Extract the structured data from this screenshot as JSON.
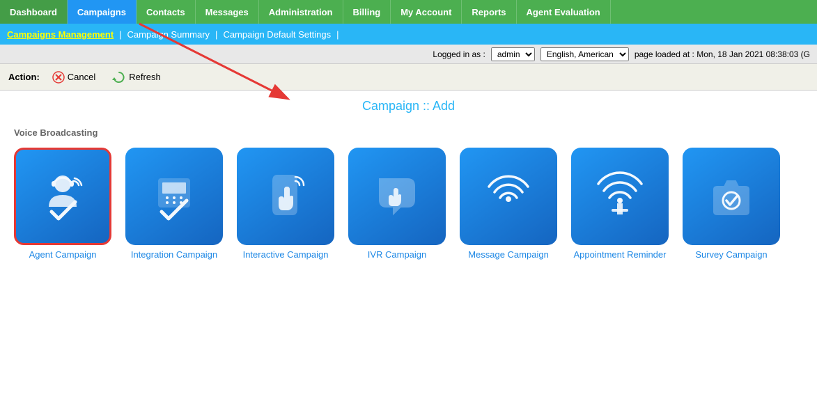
{
  "nav": {
    "items": [
      {
        "label": "Dashboard",
        "active": false
      },
      {
        "label": "Campaigns",
        "active": true
      },
      {
        "label": "Contacts",
        "active": false
      },
      {
        "label": "Messages",
        "active": false
      },
      {
        "label": "Administration",
        "active": false
      },
      {
        "label": "Billing",
        "active": false
      },
      {
        "label": "My Account",
        "active": false
      },
      {
        "label": "Reports",
        "active": false
      },
      {
        "label": "Agent Evaluation",
        "active": false
      }
    ]
  },
  "subnav": {
    "links": [
      {
        "label": "Campaigns Management",
        "type": "yellow-link"
      },
      {
        "label": "|",
        "type": "sep"
      },
      {
        "label": "Campaign Summary",
        "type": "white-link"
      },
      {
        "label": "|",
        "type": "sep"
      },
      {
        "label": "Campaign Default Settings",
        "type": "white-link"
      },
      {
        "label": "|",
        "type": "sep"
      }
    ]
  },
  "statusbar": {
    "logged_in_label": "Logged in as :",
    "user": "admin",
    "language_options": [
      "English, American"
    ],
    "language_selected": "English, American",
    "page_loaded": "page loaded at : Mon, 18 Jan 2021 08:38:03 (G"
  },
  "actionbar": {
    "action_label": "Action:",
    "cancel_label": "Cancel",
    "refresh_label": "Refresh"
  },
  "page_title": "Campaign :: Add",
  "section": {
    "label": "Voice Broadcasting"
  },
  "campaigns": [
    {
      "id": "agent",
      "name": "Agent Campaign",
      "selected": true,
      "icon": "agent"
    },
    {
      "id": "integration",
      "name": "Integration Campaign",
      "selected": false,
      "icon": "integration"
    },
    {
      "id": "interactive",
      "name": "Interactive Campaign",
      "selected": false,
      "icon": "interactive"
    },
    {
      "id": "ivr",
      "name": "IVR Campaign",
      "selected": false,
      "icon": "ivr"
    },
    {
      "id": "message",
      "name": "Message Campaign",
      "selected": false,
      "icon": "message"
    },
    {
      "id": "appointment",
      "name": "Appointment Reminder",
      "selected": false,
      "icon": "appointment"
    },
    {
      "id": "survey",
      "name": "Survey Campaign",
      "selected": false,
      "icon": "survey"
    }
  ]
}
